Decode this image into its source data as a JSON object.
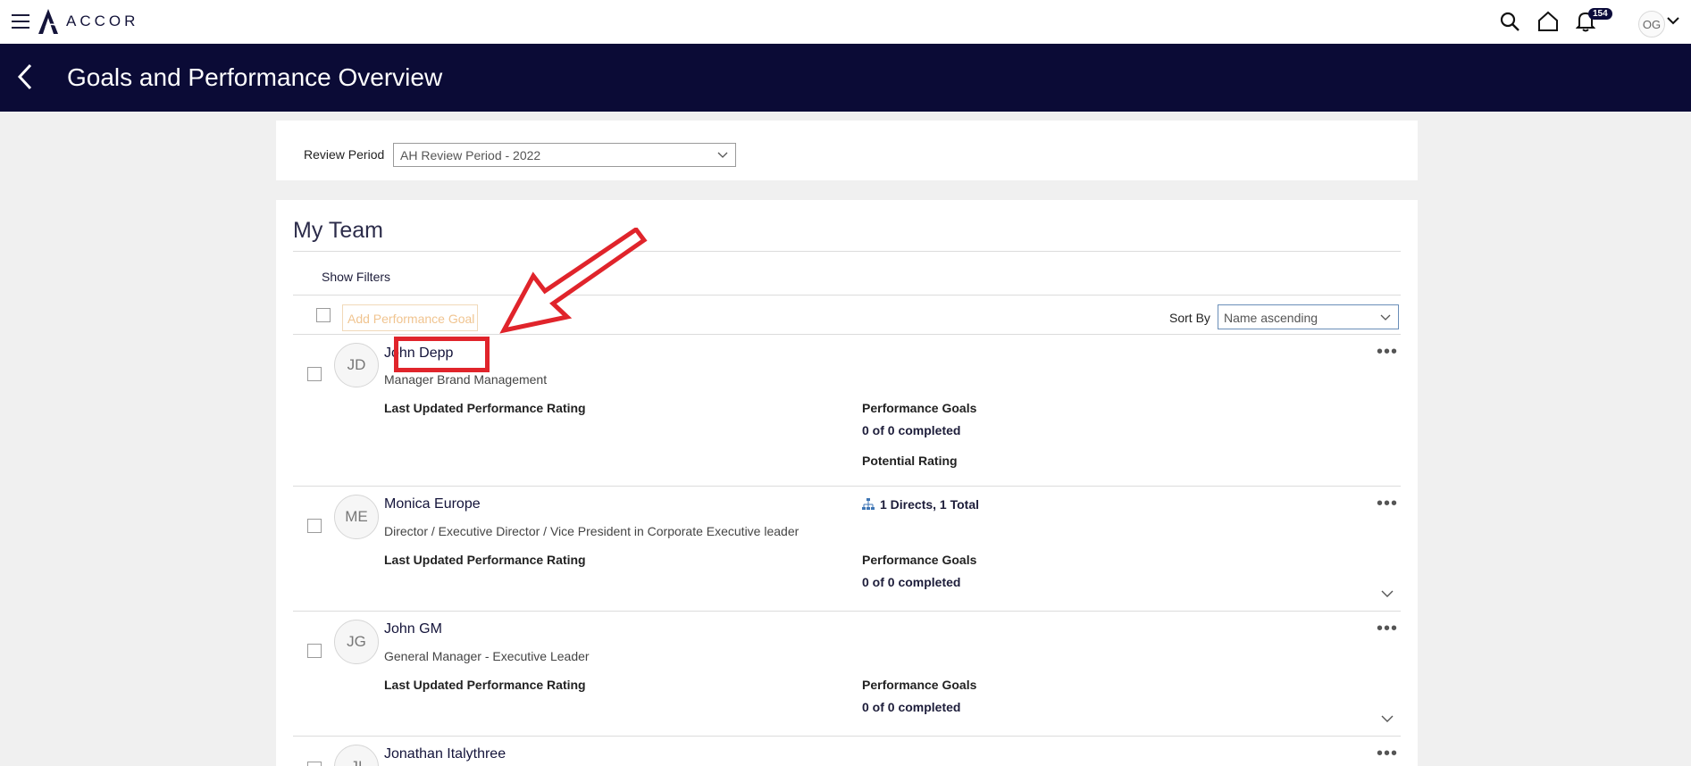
{
  "topbar": {
    "logo_text": "ACCOR",
    "notification_count": "154",
    "user_initials": "OG"
  },
  "header": {
    "title": "Goals and Performance Overview"
  },
  "review_period": {
    "label": "Review Period",
    "selected": "AH Review Period - 2022"
  },
  "team": {
    "title": "My Team",
    "show_filters": "Show Filters",
    "add_goal_label": "Add Performance Goal",
    "sort_label": "Sort By",
    "sort_selected": "Name ascending",
    "members": [
      {
        "initials": "JD",
        "name": "John Depp",
        "job": "Manager Brand Management",
        "rating_label": "Last Updated Performance Rating",
        "goals_label": "Performance Goals",
        "goals_value": "0 of 0 completed",
        "potential_label": "Potential Rating"
      },
      {
        "initials": "ME",
        "name": "Monica Europe",
        "job": "Director / Executive Director / Vice President in Corporate Executive leader",
        "directs": "1 Directs, 1 Total",
        "rating_label": "Last Updated Performance Rating",
        "goals_label": "Performance Goals",
        "goals_value": "0 of 0 completed"
      },
      {
        "initials": "JG",
        "name": "John GM",
        "job": "General Manager - Executive Leader",
        "rating_label": "Last Updated Performance Rating",
        "goals_label": "Performance Goals",
        "goals_value": "0 of 0 completed"
      },
      {
        "initials": "JI",
        "name": "Jonathan Italythree"
      }
    ]
  },
  "colors": {
    "header_bg": "#0b0b36",
    "annotation_red": "#e0242b"
  }
}
